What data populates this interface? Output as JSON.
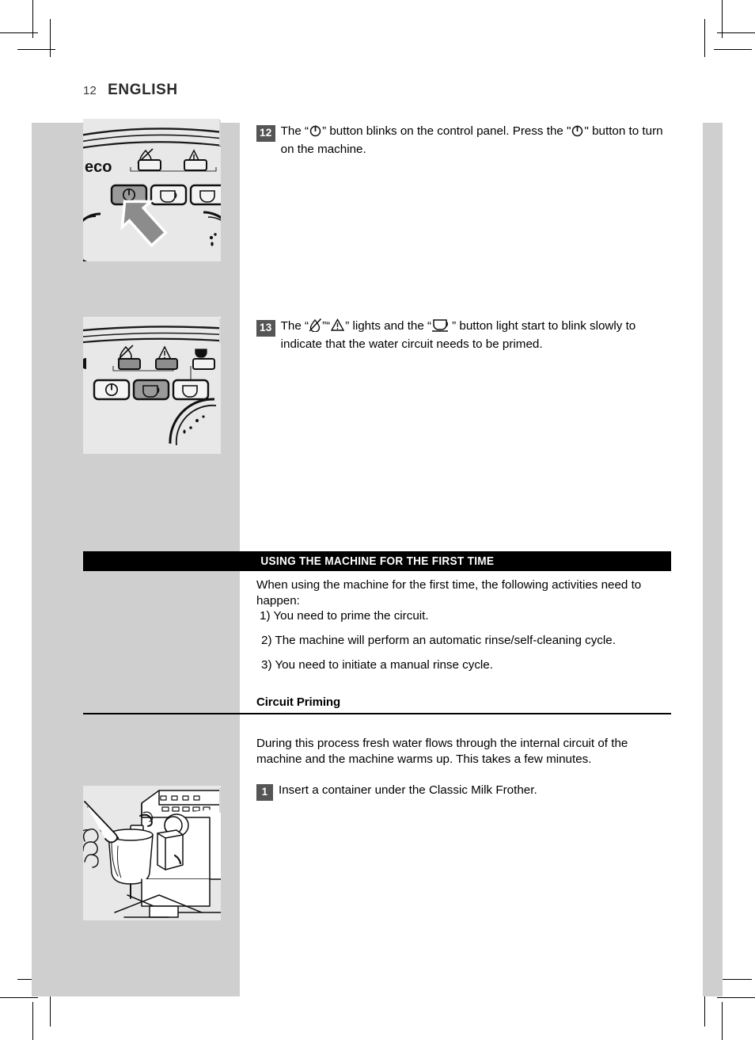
{
  "page": {
    "number": "12",
    "language_title": "ENGLISH"
  },
  "colors": {
    "grey_column": "#cfcfcf",
    "figure_background": "#e8e8e8",
    "badge": "#555555",
    "section_bar": "#000000",
    "highlight_button": "#9a9a9a"
  },
  "steps": [
    {
      "number": "12",
      "text_before_icon1": "The “",
      "icon1": "power-icon",
      "text_middle": "” button blinks on the control panel. Press the \"",
      "icon2": "power-icon",
      "text_after": "\" button to turn on the machine."
    },
    {
      "number": "13",
      "text_before_icon1": "The “",
      "icon1": "no-water-icon",
      "text_middle": "”“",
      "icon2": "warning-triangle-icon",
      "text_middle2": "” lights and the “",
      "icon3": "espresso-cup-icon",
      "text_after": "” button light start to blink slowly to indicate that the water circuit needs to be primed."
    }
  ],
  "section": {
    "title": "USING THE MACHINE FOR THE FIRST TIME",
    "intro": "When using the machine for the first time, the following activities need to happen:",
    "items": [
      "1) You need to prime the circuit.",
      "2) The machine will perform an automatic rinse/self-cleaning cycle.",
      "3) You need to initiate a manual rinse cycle."
    ]
  },
  "subsection": {
    "title": "Circuit Priming",
    "paragraph": "During this process fresh water flows through the internal circuit of the machine and the machine warms up. This takes a few minutes.",
    "step": {
      "number": "1",
      "text": "Insert a container under the Classic Milk Frother."
    }
  },
  "figures": {
    "control_panel_power": {
      "brand_text": "eco",
      "indicators": [
        "no-water-icon",
        "warning-triangle-icon"
      ],
      "buttons": [
        "power-icon",
        "espresso-cup-icon",
        "coffee-cup-icon"
      ],
      "callout": "arrow-pointing-to-power-button"
    },
    "control_panel_blink": {
      "indicators": [
        "no-water-icon",
        "warning-triangle-icon",
        "coffee-cup-icon"
      ],
      "buttons": [
        "power-icon",
        "espresso-cup-icon",
        "coffee-cup-icon"
      ],
      "highlighted_button": "espresso-cup-icon"
    },
    "milk_frother": {
      "description": "hand-placing-pitcher-under-milk-frother"
    }
  }
}
